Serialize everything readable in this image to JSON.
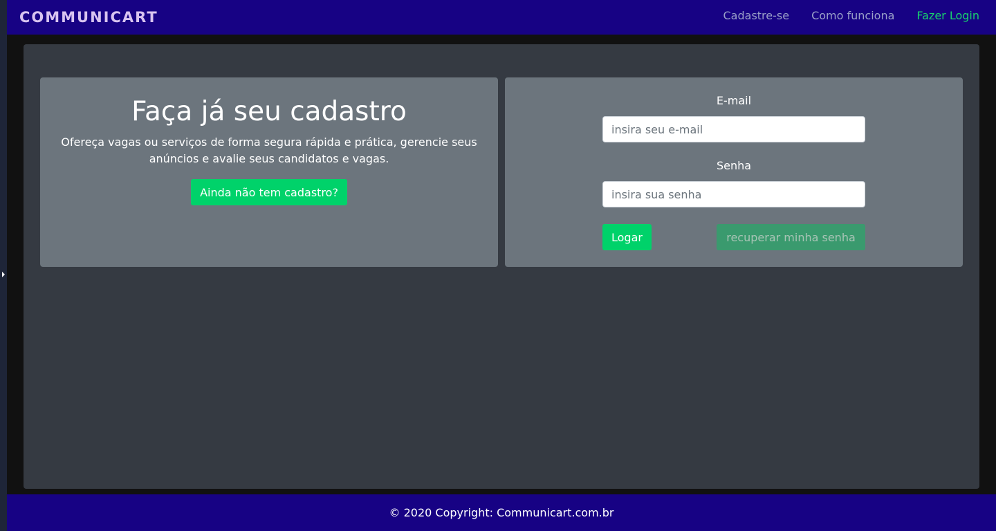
{
  "navbar": {
    "brand": "COMMUNICART",
    "links": [
      {
        "label": "Cadastre-se"
      },
      {
        "label": "Como funciona"
      },
      {
        "label": "Fazer Login"
      }
    ]
  },
  "signup_card": {
    "title": "Faça já seu cadastro",
    "description": "Ofereça vagas ou serviços de forma segura rápida e prática, gerencie seus anúncios e avalie seus candidatos e vagas.",
    "button_label": "Ainda não tem cadastro?"
  },
  "login_card": {
    "email_label": "E-mail",
    "email_placeholder": "insira seu e-mail",
    "email_value": "",
    "password_label": "Senha",
    "password_placeholder": "insira sua senha",
    "password_value": "",
    "login_button": "Logar",
    "recover_button": "recuperar minha senha"
  },
  "footer": {
    "copyright": "© 2020 Copyright: Communicart.com.br"
  },
  "colors": {
    "navbar_bg": "#170284",
    "accent_green": "#00d26a",
    "panel_bg": "#353a42",
    "card_bg": "#6c757d"
  }
}
